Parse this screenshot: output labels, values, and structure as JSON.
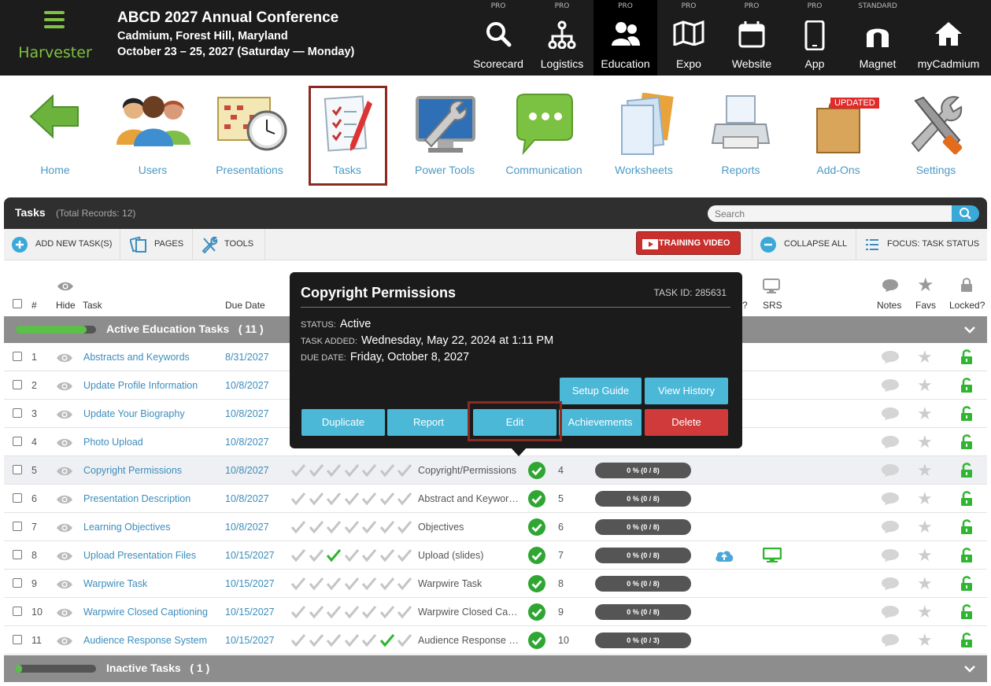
{
  "header": {
    "brand": "Harvester",
    "event_title": "ABCD 2027 Annual Conference",
    "event_location": "Cadmium, Forest Hill, Maryland",
    "event_dates": "October 23 – 25, 2027 (Saturday — Monday)"
  },
  "topnav": [
    {
      "tier": "PRO",
      "label": "Scorecard",
      "icon": "search-icon"
    },
    {
      "tier": "PRO",
      "label": "Logistics",
      "icon": "org-chart-icon"
    },
    {
      "tier": "PRO",
      "label": "Education",
      "icon": "people-icon"
    },
    {
      "tier": "PRO",
      "label": "Expo",
      "icon": "map-icon"
    },
    {
      "tier": "PRO",
      "label": "Website",
      "icon": "calendar-icon"
    },
    {
      "tier": "PRO",
      "label": "App",
      "icon": "phone-icon"
    },
    {
      "tier": "STANDARD",
      "label": "Magnet",
      "icon": "magnet-icon"
    },
    {
      "tier": "",
      "label": "myCadmium",
      "icon": "home-icon"
    }
  ],
  "apps": [
    {
      "label": "Home"
    },
    {
      "label": "Users"
    },
    {
      "label": "Presentations"
    },
    {
      "label": "Tasks"
    },
    {
      "label": "Power Tools"
    },
    {
      "label": "Communication"
    },
    {
      "label": "Worksheets"
    },
    {
      "label": "Reports"
    },
    {
      "label": "Add-Ons",
      "badge": "UPDATED"
    },
    {
      "label": "Settings"
    }
  ],
  "panel": {
    "title": "Tasks",
    "record_count": "(Total Records: 12)",
    "search_placeholder": "Search"
  },
  "toolbar": {
    "add": "ADD NEW TASK(S)",
    "pages": "PAGES",
    "tools": "TOOLS",
    "training": "TRAINING VIDEO",
    "collapse": "COLLAPSE ALL",
    "focus": "FOCUS: TASK STATUS"
  },
  "columns": {
    "num": "#",
    "hide": "Hide",
    "task": "Task",
    "due": "Due Date",
    "q": "?",
    "srs": "SRS",
    "notes": "Notes",
    "favs": "Favs",
    "locked": "Locked?"
  },
  "groups": {
    "active": {
      "label": "Active Education Tasks",
      "count": "( 11 )",
      "fill": 0.88
    },
    "inactive": {
      "label": "Inactive Tasks",
      "count": "( 1 )",
      "fill": 0.08
    }
  },
  "rows": [
    {
      "num": "1",
      "task": "Abstracts and Keywords",
      "due": "8/31/2027"
    },
    {
      "num": "2",
      "task": "Update Profile Information",
      "due": "10/8/2027"
    },
    {
      "num": "3",
      "task": "Update Your Biography",
      "due": "10/8/2027"
    },
    {
      "num": "4",
      "task": "Photo Upload",
      "due": "10/8/2027"
    },
    {
      "num": "5",
      "task": "Copyright Permissions",
      "due": "10/8/2027",
      "category": "Copyright/Permissions",
      "order": "4",
      "progress": "0 % (0 / 8)",
      "green_check": -1
    },
    {
      "num": "6",
      "task": "Presentation Description",
      "due": "10/8/2027",
      "category": "Abstract and Keywords",
      "order": "5",
      "progress": "0 % (0 / 8)",
      "green_check": -1
    },
    {
      "num": "7",
      "task": "Learning Objectives",
      "due": "10/8/2027",
      "category": "Objectives",
      "order": "6",
      "progress": "0 % (0 / 8)",
      "green_check": -1
    },
    {
      "num": "8",
      "task": "Upload Presentation Files",
      "due": "10/15/2027",
      "category": "Upload (slides)",
      "order": "7",
      "progress": "0 % (0 / 8)",
      "green_check": 2,
      "cloud": true,
      "srs": true
    },
    {
      "num": "9",
      "task": "Warpwire Task",
      "due": "10/15/2027",
      "category": "Warpwire Task",
      "order": "8",
      "progress": "0 % (0 / 8)",
      "green_check": -1
    },
    {
      "num": "10",
      "task": "Warpwire Closed Captioning",
      "due": "10/15/2027",
      "category": "Warpwire Closed Captioning",
      "order": "9",
      "progress": "0 % (0 / 8)",
      "green_check": -1
    },
    {
      "num": "11",
      "task": "Audience Response System",
      "due": "10/15/2027",
      "category": "Audience Response System",
      "order": "10",
      "progress": "0 % (0 / 3)",
      "green_check": 5
    }
  ],
  "popup": {
    "title": "Copyright Permissions",
    "task_id": "TASK ID: 285631",
    "status_label": "STATUS:",
    "status_value": "Active",
    "added_label": "TASK ADDED:",
    "added_value": "Wednesday, May 22, 2024 at 1:11 PM",
    "due_label": "DUE DATE:",
    "due_value": "Friday, October 8, 2027",
    "btn_setup": "Setup Guide",
    "btn_history": "View History",
    "btn_duplicate": "Duplicate",
    "btn_report": "Report",
    "btn_edit": "Edit",
    "btn_achievements": "Achievements",
    "btn_delete": "Delete"
  },
  "colors": {
    "accent": "#4cb8d8",
    "brand_green": "#7fc242",
    "danger": "#d13a3a",
    "link": "#3c8dbc"
  }
}
